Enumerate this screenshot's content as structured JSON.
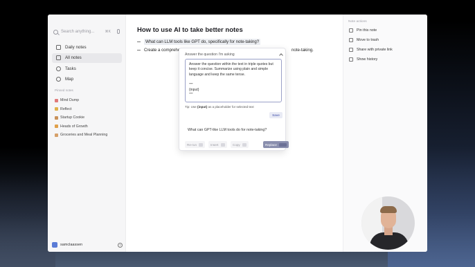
{
  "sidebar": {
    "search_placeholder": "Search anything...",
    "search_shortcut": "⌘K",
    "nav": [
      {
        "label": "Daily notes",
        "icon": "calendar-icon"
      },
      {
        "label": "All notes",
        "icon": "notes-icon"
      },
      {
        "label": "Tasks",
        "icon": "check-circle-icon"
      },
      {
        "label": "Map",
        "icon": "map-icon"
      }
    ],
    "pinned_title": "Pinned notes",
    "pinned": [
      {
        "label": "Mind Dump",
        "color": "#e07a7a"
      },
      {
        "label": "Reflect",
        "color": "#e0b24a"
      },
      {
        "label": "Startup Cookie",
        "color": "#c9925a"
      },
      {
        "label": "Heads of Growth",
        "color": "#e0a04a"
      },
      {
        "label": "Groceries and Meal Planning",
        "color": "#d6a06a"
      }
    ],
    "user": {
      "name": "samclaassen",
      "help": "?"
    }
  },
  "document": {
    "title": "How to use AI to take better notes",
    "bullets": [
      "What can LLM tools like GPT do, specifically for note-taking?",
      "Create a comprehe"
    ],
    "bullet_tail": "note-taking."
  },
  "ai_popup": {
    "prompt_selector": "Answer the question I'm asking",
    "prompt_text": "Answer the question within the text in triple quotes but keep it concise. Summarize using plain and simple language and keep the same tense.\n\n\"\"\"\n{input}\n\"\"\"",
    "tip_prefix": "Tip: Use",
    "tip_code": "{input}",
    "tip_suffix": "as a placeholder for selected text",
    "save_label": "Save",
    "response_text": "What can GPT-like LLM tools do for note-taking?",
    "actions": [
      {
        "label": "Re-run"
      },
      {
        "label": "Insert"
      },
      {
        "label": "Copy"
      },
      {
        "label": "Replace"
      }
    ]
  },
  "right_panel": {
    "title": "Note actions",
    "actions": [
      {
        "label": "Pin this note",
        "icon": "pin-icon"
      },
      {
        "label": "Move to trash",
        "icon": "trash-icon"
      },
      {
        "label": "Share with private link",
        "icon": "link-icon"
      },
      {
        "label": "Show history",
        "icon": "history-icon"
      }
    ]
  }
}
